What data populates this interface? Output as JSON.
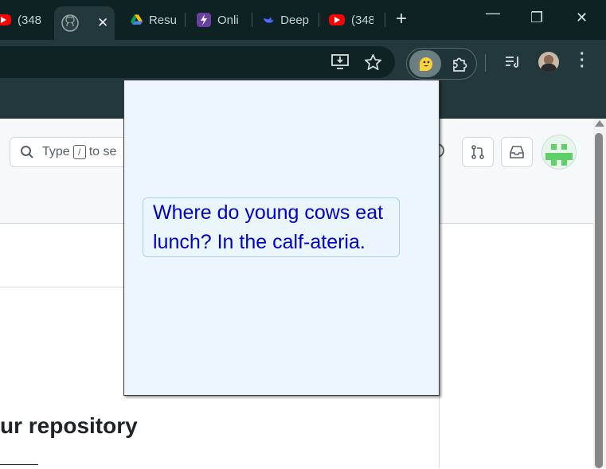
{
  "tabs": [
    {
      "title": "(348",
      "icon": "youtube-icon"
    },
    {
      "title": "",
      "icon": "github-icon",
      "active": true,
      "close": "✕"
    },
    {
      "title": "Resu",
      "icon": "google-drive-icon"
    },
    {
      "title": "Onli",
      "icon": "bolt-icon"
    },
    {
      "title": "Deep",
      "icon": "deepseek-icon"
    },
    {
      "title": "(348",
      "icon": "youtube-icon"
    }
  ],
  "new_tab_label": "+",
  "window_controls": {
    "minimize": "—",
    "restore": "❐",
    "close": "✕"
  },
  "github": {
    "search_prefix": "Type",
    "search_key": "/",
    "search_suffix": "to se",
    "repo_heading": "ur repository"
  },
  "popup": {
    "joke": "Where do young cows eat lunch? In the calf-ateria."
  },
  "colors": {
    "chrome_dark": "#0e2224",
    "chrome_toolbar": "#22383a",
    "popup_bg": "#eef6fd",
    "joke_text": "#0000cc"
  }
}
